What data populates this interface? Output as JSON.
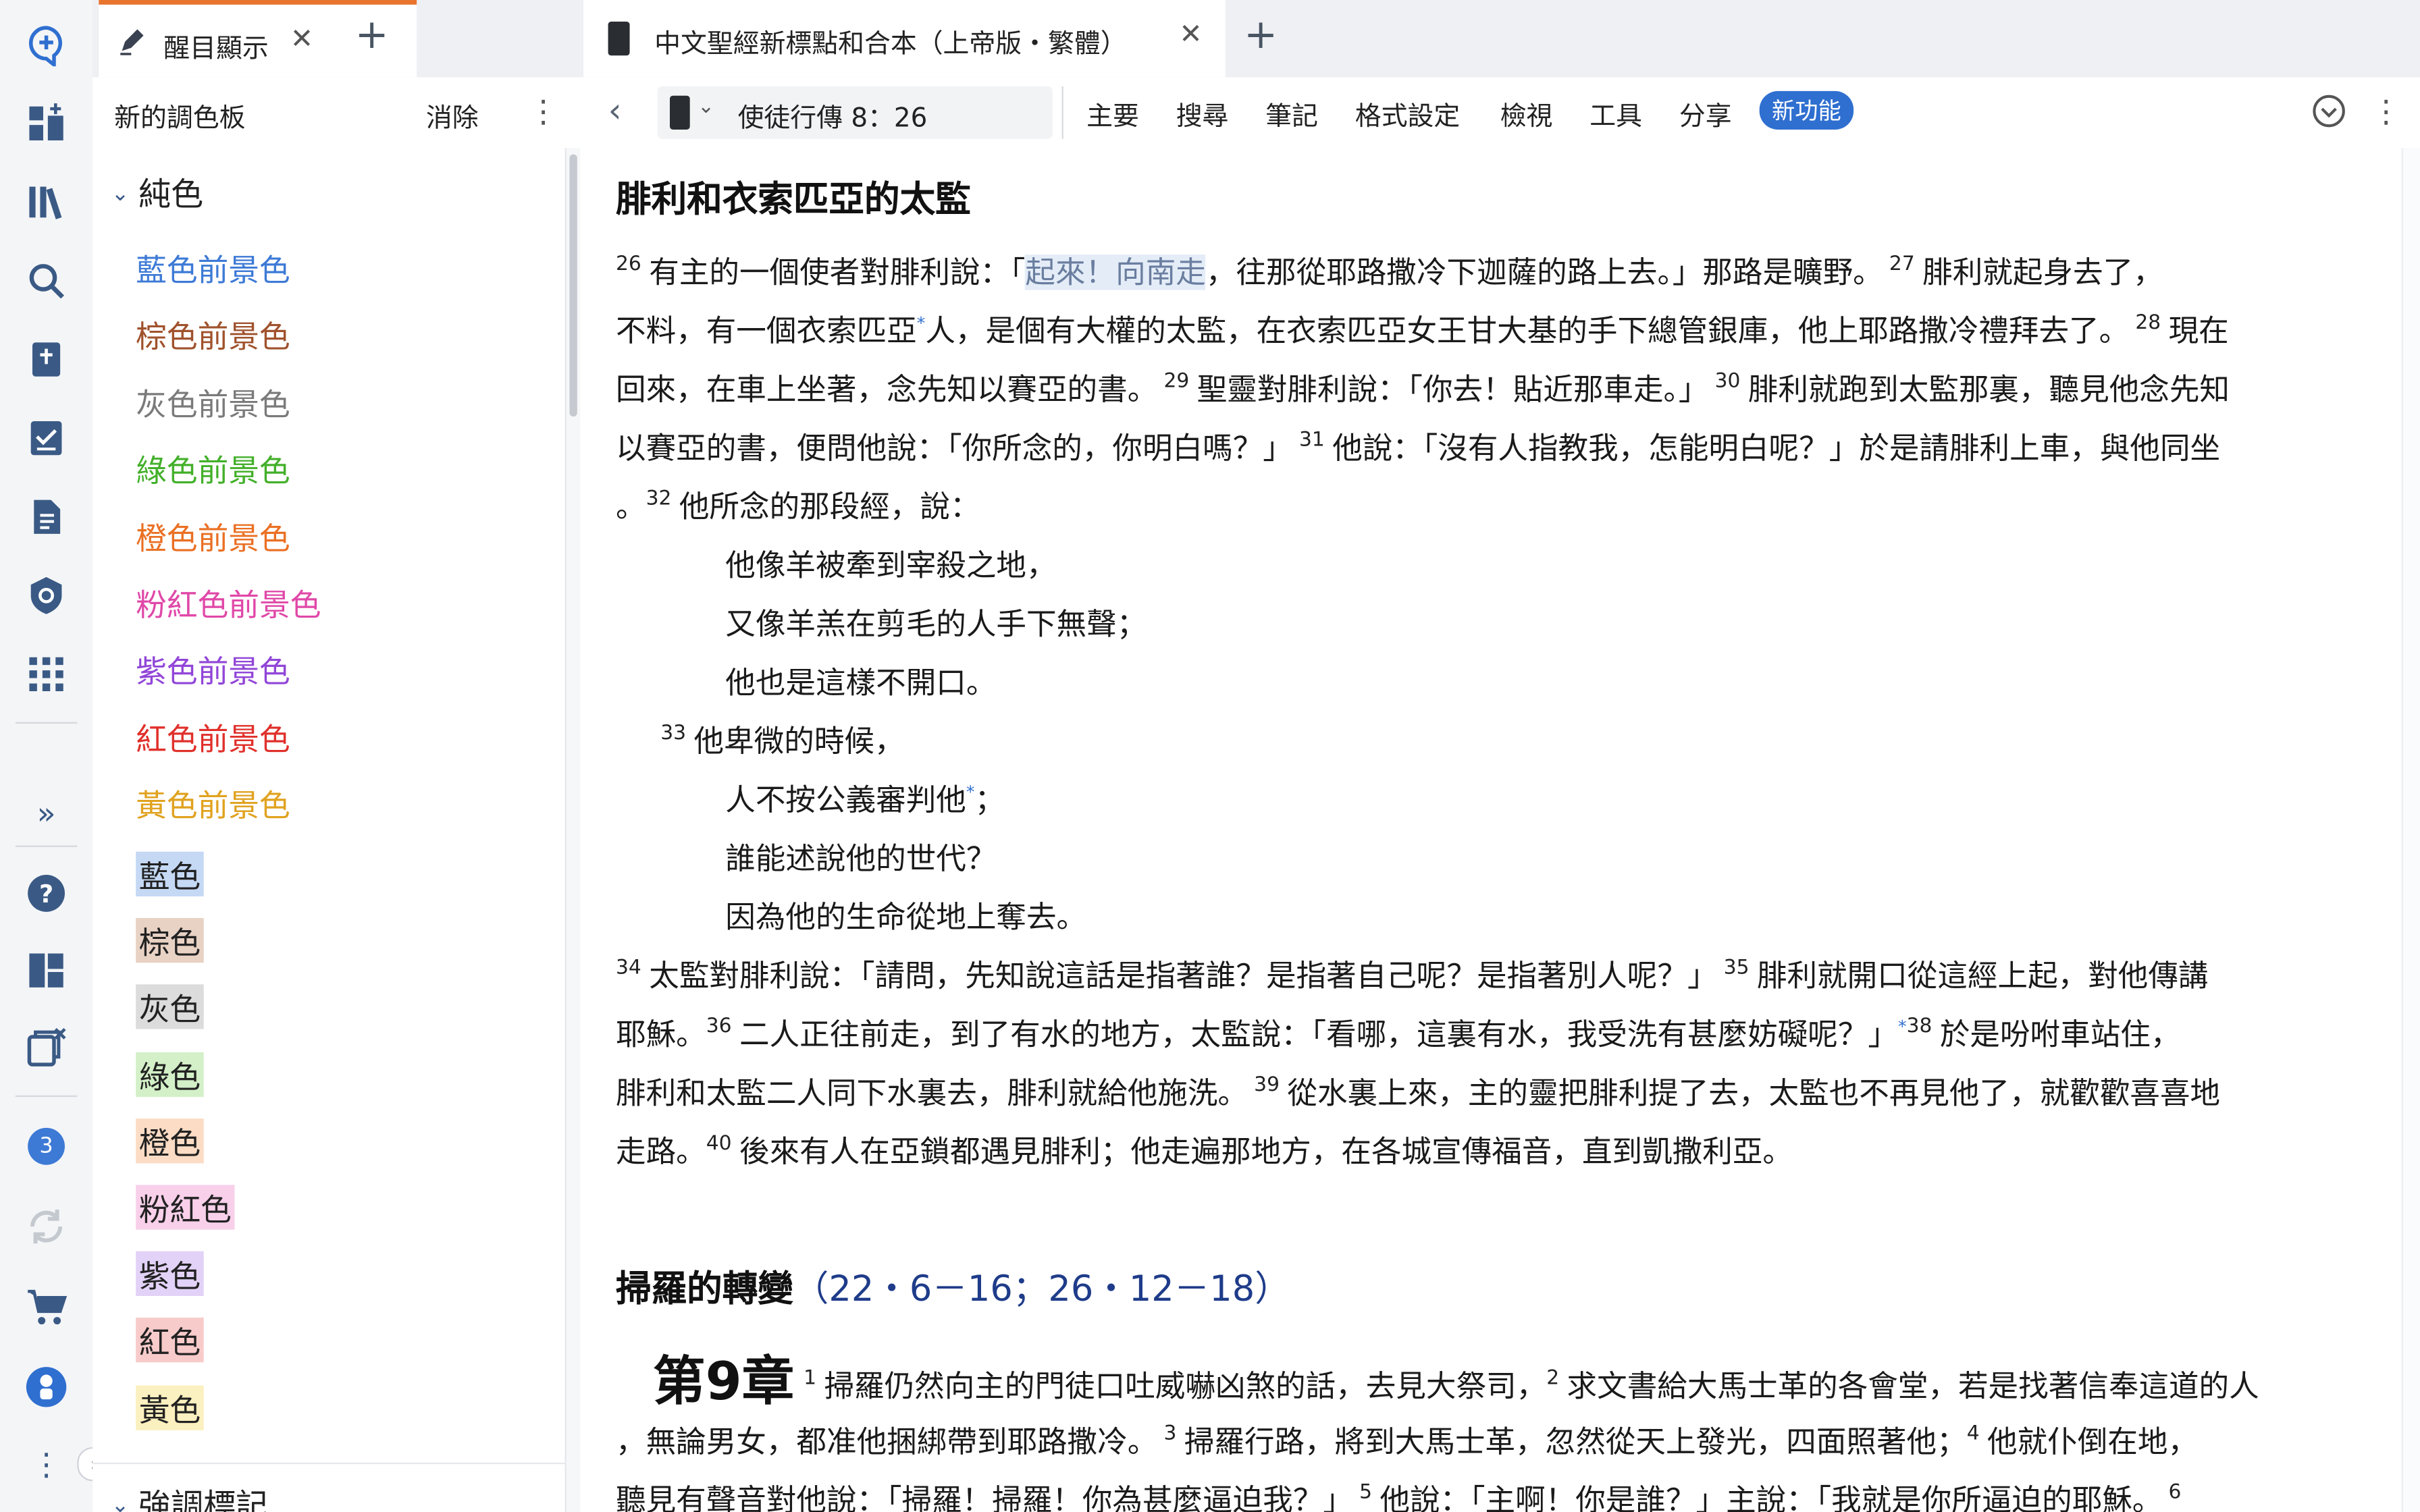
{
  "left_panel": {
    "tab": {
      "label": "醒目顯示",
      "close": "✕",
      "add": "+"
    },
    "header": {
      "title": "新的調色板",
      "clear": "消除"
    },
    "section_solid": "純色",
    "foreground_items": [
      {
        "label": "藍色前景色",
        "color": "#3d7ad6"
      },
      {
        "label": "棕色前景色",
        "color": "#a0522d"
      },
      {
        "label": "灰色前景色",
        "color": "#7a7a7a"
      },
      {
        "label": "綠色前景色",
        "color": "#43b02a"
      },
      {
        "label": "橙色前景色",
        "color": "#ea7024"
      },
      {
        "label": "粉紅色前景色",
        "color": "#e048a8"
      },
      {
        "label": "紫色前景色",
        "color": "#9146d8"
      },
      {
        "label": "紅色前景色",
        "color": "#e0302b"
      },
      {
        "label": "黃色前景色",
        "color": "#e0a21f"
      }
    ],
    "highlight_items": [
      {
        "label": "藍色",
        "color": "#c5d9f5"
      },
      {
        "label": "棕色",
        "color": "#e8d2c4"
      },
      {
        "label": "灰色",
        "color": "#dcdcdc"
      },
      {
        "label": "綠色",
        "color": "#d3f0c8"
      },
      {
        "label": "橙色",
        "color": "#fcdcc4"
      },
      {
        "label": "粉紅色",
        "color": "#f8d0ea"
      },
      {
        "label": "紫色",
        "color": "#e3d2f7"
      },
      {
        "label": "紅色",
        "color": "#f8cbcb"
      },
      {
        "label": "黃色",
        "color": "#fbf0bf"
      }
    ],
    "section_emphasis": "強調標記"
  },
  "rail": {
    "badge_count": "3"
  },
  "right_panel": {
    "tab": {
      "label": "中文聖經新標點和合本（上帝版・繁體）",
      "close": "✕",
      "add": "+"
    },
    "reference": "使徒行傳 8：26",
    "menu": [
      "主要",
      "搜尋",
      "筆記",
      "格式設定",
      "檢視",
      "工具",
      "分享"
    ],
    "new_feature": "新功能"
  },
  "text": {
    "heading1": "腓利和衣索匹亞的太監",
    "l1_v": "26",
    "l1_a": "有主的一個使者對腓利說：「",
    "l1_sel": "起來！向南走",
    "l1_b": "，往那從耶路撒冷下迦薩的路上去。」那路是曠野。",
    "l1_v2": "27",
    "l1_c": "腓利就起身去了，",
    "l2_a": "不料，有一個衣索匹亞",
    "l2_fn": "*",
    "l2_b": "人，是個有大權的太監，在衣索匹亞女王甘大基的手下總管銀庫，他上耶路撒冷禮拜去了。",
    "l2_v": "28",
    "l2_c": "現在",
    "l3_a": "回來，在車上坐著，念先知以賽亞的書。",
    "l3_v": "29",
    "l3_b": "聖靈對腓利說：「你去！貼近那車走。」",
    "l3_v2": "30",
    "l3_c": "腓利就跑到太監那裏，聽見他念先知",
    "l4_a": "以賽亞的書，便問他說：「你所念的，你明白嗎？」",
    "l4_v": "31",
    "l4_b": "他說：「沒有人指教我，怎能明白呢？」於是請腓利上車，與他同坐",
    "l5_a": "。",
    "l5_v": "32",
    "l5_b": "他所念的那段經，說：",
    "p1": "他像羊被牽到宰殺之地，",
    "p2": "又像羊羔在剪毛的人手下無聲；",
    "p3": "他也是這樣不開口。",
    "p4_v": "33",
    "p4": "他卑微的時候，",
    "p5": "人不按公義審判他",
    "p5_fn": "*",
    "p5_end": "；",
    "p6": "誰能述說他的世代？",
    "p7": "因為他的生命從地上奪去。",
    "l6_v": "34",
    "l6_a": "太監對腓利說：「請問，先知說這話是指著誰？是指著自己呢？是指著別人呢？」",
    "l6_v2": "35",
    "l6_b": "腓利就開口從這經上起，對他傳講",
    "l7_a": "耶穌。",
    "l7_v": "36",
    "l7_b": "二人正往前走，到了有水的地方，太監說：「看哪，這裏有水，我受洗有甚麼妨礙呢？」",
    "l7_fn": "*",
    "l7_v2": "38",
    "l7_c": "於是吩咐車站住，",
    "l8_a": "腓利和太監二人同下水裏去，腓利就給他施洗。",
    "l8_v": "39",
    "l8_b": "從水裏上來，主的靈把腓利提了去，太監也不再見他了，就歡歡喜喜地",
    "l9_a": "走路。",
    "l9_v": "40",
    "l9_b": "後來有人在亞鎖都遇見腓利；他走遍那地方，在各城宣傳福音，直到凱撒利亞。",
    "heading2": "掃羅的轉變",
    "heading2_ref": "（22・6－16；26・12－18）",
    "chapter": "第9章",
    "c1_v": "1",
    "c1_a": "掃羅仍然向主的門徒口吐威嚇凶煞的話，去見大祭司，",
    "c1_v2": "2",
    "c1_b": "求文書給大馬士革的各會堂，若是找著信奉這道的人",
    "c2_a": "，無論男女，都准他捆綁帶到耶路撒冷。",
    "c2_v": "3",
    "c2_b": "掃羅行路，將到大馬士革，忽然從天上發光，四面照著他；",
    "c2_v2": "4",
    "c2_c": "他就仆倒在地，",
    "c3_a": "聽見有聲音對他說：「掃羅！掃羅！你為甚麼逼迫我？」",
    "c3_v": "5",
    "c3_b": "他說：「主啊！你是誰？」主說：「我就是你所逼迫的耶穌。",
    "c3_v2": "6"
  }
}
